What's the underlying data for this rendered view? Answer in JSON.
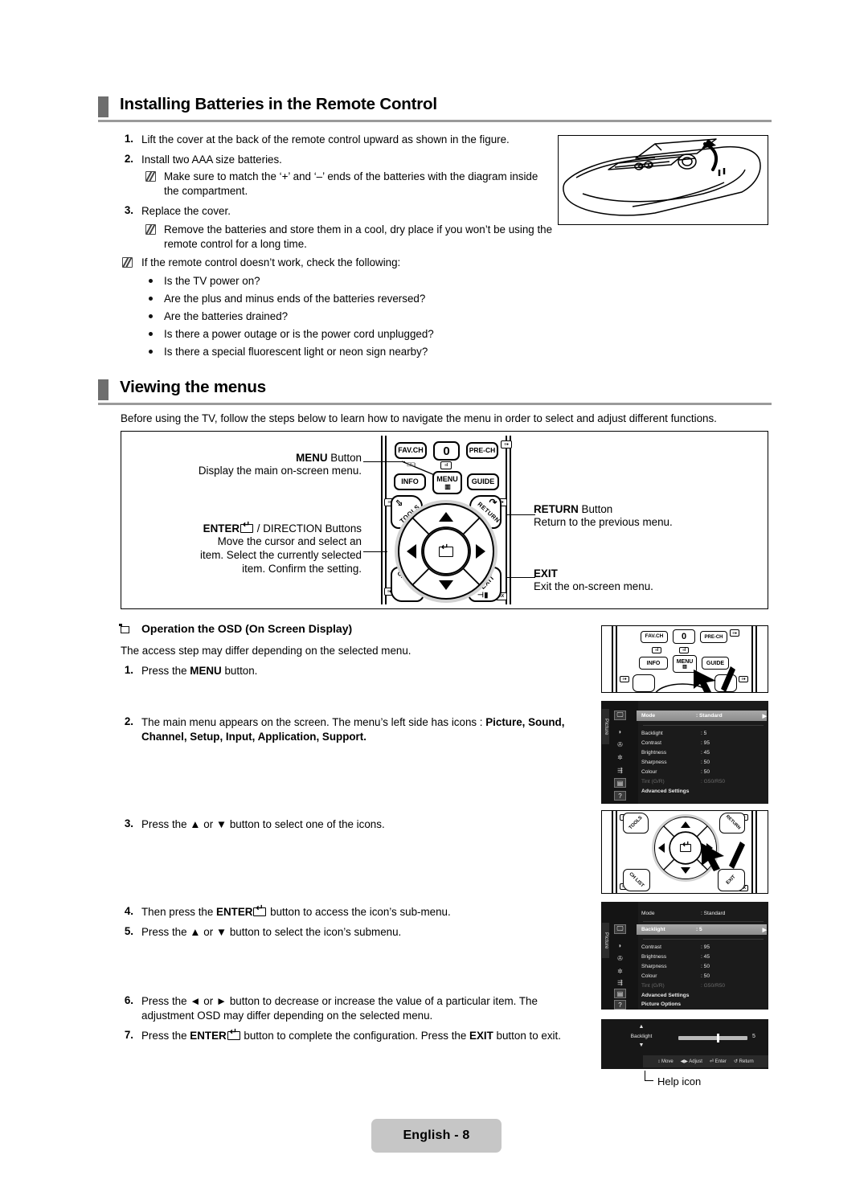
{
  "sections": {
    "batteries": {
      "heading": "Installing Batteries in the Remote Control",
      "steps": [
        {
          "num": "1.",
          "text": "Lift the cover at the back of the remote control upward as shown in the figure."
        },
        {
          "num": "2.",
          "text": "Install two AAA size batteries."
        },
        {
          "num": "3.",
          "text": "Replace the cover."
        }
      ],
      "notes": [
        "Make sure to match the ‘+’ and ‘–’ ends of the batteries with the diagram inside the compartment.",
        "Remove the batteries and store them in a cool, dry place if you won’t be using the remote control for a long time.",
        "If the remote control doesn’t work, check the following:"
      ],
      "checklist": [
        "Is the TV power on?",
        "Are the plus and minus ends of the batteries reversed?",
        "Are the batteries drained?",
        "Is there a power outage or is the power cord unplugged?",
        "Is there a special fluorescent light or neon sign nearby?"
      ]
    },
    "viewing": {
      "heading": "Viewing the menus",
      "intro": "Before using the TV, follow the steps below to learn how to navigate the menu in order to select and adjust different functions.",
      "callouts": {
        "menu_title_bold": "MENU",
        "menu_title_rest": " Button",
        "menu_desc": "Display the main on-screen menu.",
        "enter_title_bold": "ENTER",
        "enter_title_rest": " / DIRECTION Buttons",
        "enter_desc_line1": "Move the cursor and select an",
        "enter_desc_line2": "item. Select the currently selected",
        "enter_desc_line3": "item. Confirm the setting.",
        "return_title_bold": "RETURN",
        "return_title_rest": " Button",
        "return_desc": "Return to the previous menu.",
        "exit_title_bold": "EXIT",
        "exit_desc": "Exit the on-screen menu."
      }
    },
    "osd": {
      "subheading": "Operation the OSD (On Screen Display)",
      "lead": "The access step may differ depending on the selected menu.",
      "steps": [
        {
          "num": "1.",
          "text": "Press the MENU button.",
          "pre": "Press the ",
          "bold": "MENU",
          "post": " button."
        },
        {
          "num": "2.",
          "text": "The main menu appears on the screen. The menu’s left side has icons : Picture, Sound, Channel, Setup, Input, Application, Support.",
          "pre": "The main menu appears on the screen. The menu’s left side has icons : ",
          "bold": "Picture, Sound, Channel, Setup, Input, Application, Support.",
          "post": ""
        },
        {
          "num": "3.",
          "text": "Press the ▲ or ▼ button to select one of the icons."
        },
        {
          "num": "4.",
          "text": "Then press the ENTER button to access the icon’s sub-menu.",
          "pre": "Then press the ",
          "bold": "ENTER",
          "post": " button to access the icon’s sub-menu."
        },
        {
          "num": "5.",
          "text": "Press the ▲ or ▼ button to select the icon’s submenu."
        },
        {
          "num": "6.",
          "text": "Press the ◄ or ► button to decrease or increase the value of a particular item. The adjustment OSD may differ depending on the selected menu."
        },
        {
          "num": "7.",
          "text": "Press the ENTER button to complete the configuration. Press the EXIT button to exit.",
          "pre": "Press the ",
          "bold": "ENTER",
          "mid": " button to complete the configuration. Press the ",
          "bold2": "EXIT",
          "post": " button to exit."
        }
      ]
    }
  },
  "remote": {
    "buttons": {
      "favch": "FAV.CH",
      "zero": "0",
      "prech": "PRE-CH",
      "info": "INFO",
      "menu": "MENU",
      "guide": "GUIDE",
      "tools": "TOOLS",
      "return": "RETURN",
      "chlist": "CH LIST",
      "exit": "EXIT"
    },
    "side_tags": [
      "≡●",
      "≡I",
      "≡♦",
      "≡♦",
      "≡◆",
      "≡X"
    ]
  },
  "osd_panels": {
    "picture_mode": {
      "rail_label": "Picture",
      "rows": [
        {
          "label": "Mode",
          "value": ": Standard",
          "highlight": true,
          "chevron": "▶"
        },
        {
          "label": "Backlight",
          "value": ": 5"
        },
        {
          "label": "Contrast",
          "value": ": 95"
        },
        {
          "label": "Brightness",
          "value": ": 45"
        },
        {
          "label": "Sharpness",
          "value": ": 50"
        },
        {
          "label": "Colour",
          "value": ": 50"
        },
        {
          "label": "Tint (G/R)",
          "value": ": G50/R50",
          "dim": true
        },
        {
          "label": "Advanced Settings",
          "value": ""
        }
      ]
    },
    "picture_backlight": {
      "rail_label": "Picture",
      "rows": [
        {
          "label": "Mode",
          "value": ": Standard"
        },
        {
          "label": "Backlight",
          "value": ": 5",
          "highlight": true,
          "chevron": "▶"
        },
        {
          "label": "Contrast",
          "value": ": 95"
        },
        {
          "label": "Brightness",
          "value": ": 45"
        },
        {
          "label": "Sharpness",
          "value": ": 50"
        },
        {
          "label": "Colour",
          "value": ": 50"
        },
        {
          "label": "Tint (G/R)",
          "value": ": G50/R50",
          "dim": true
        },
        {
          "label": "Advanced Settings",
          "value": ""
        },
        {
          "label": "Picture Options",
          "value": ""
        }
      ]
    },
    "adjust": {
      "label": "Backlight",
      "value": "5",
      "up_arrow": "▲",
      "down_arrow": "▼",
      "help": [
        {
          "icon": "↕",
          "text": "Move"
        },
        {
          "icon": "◀▶",
          "text": "Adjust"
        },
        {
          "icon": "⏎",
          "text": "Enter"
        },
        {
          "icon": "↺",
          "text": "Return"
        }
      ],
      "callout": "Help icon"
    }
  },
  "footer": {
    "page_label": "English - 8"
  },
  "colors": {
    "heading_bar": "#6e6e6e",
    "heading_rule": "#9a9a9a",
    "osd_bg": "#1b1b1b",
    "osd_highlight": "#9a9a9a",
    "footer_bg": "#c6c6c6"
  }
}
